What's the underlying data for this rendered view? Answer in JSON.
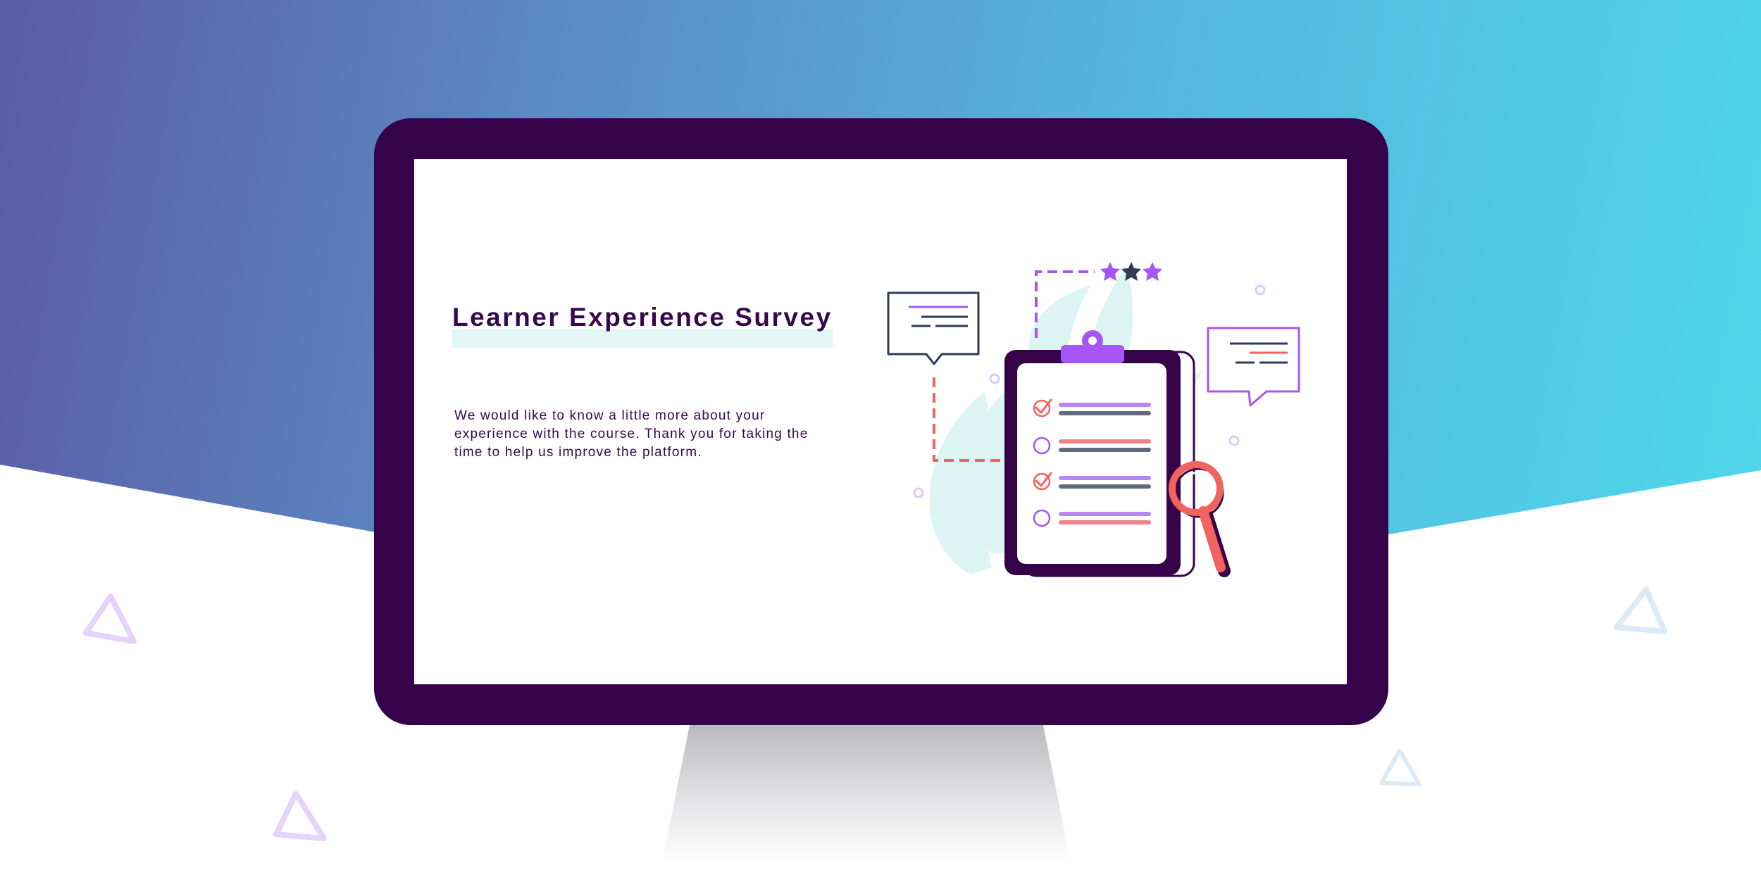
{
  "survey": {
    "title": "Learner Experience Survey",
    "intro_text": "We would like to know a little more about your experience with the course. Thank you for taking the time to help us improve the platform."
  },
  "illustration": {
    "icons": [
      "clipboard-icon",
      "speech-bubble-icon",
      "magnifier-icon",
      "star-icon",
      "checkmark-icon",
      "triangle-icon"
    ],
    "checklist": [
      {
        "checked": true
      },
      {
        "checked": false
      },
      {
        "checked": true
      },
      {
        "checked": false
      }
    ],
    "rating_stars": 3
  },
  "colors": {
    "monitor_frame": "#360249",
    "title_text": "#35084d",
    "title_highlight": "#e2f6f6",
    "accent_purple": "#a656f6",
    "accent_coral": "#f2625e",
    "leaf_mint": "#dcf5f3",
    "gradient_start": "#5a5ba4",
    "gradient_end": "#4fd7ea"
  }
}
